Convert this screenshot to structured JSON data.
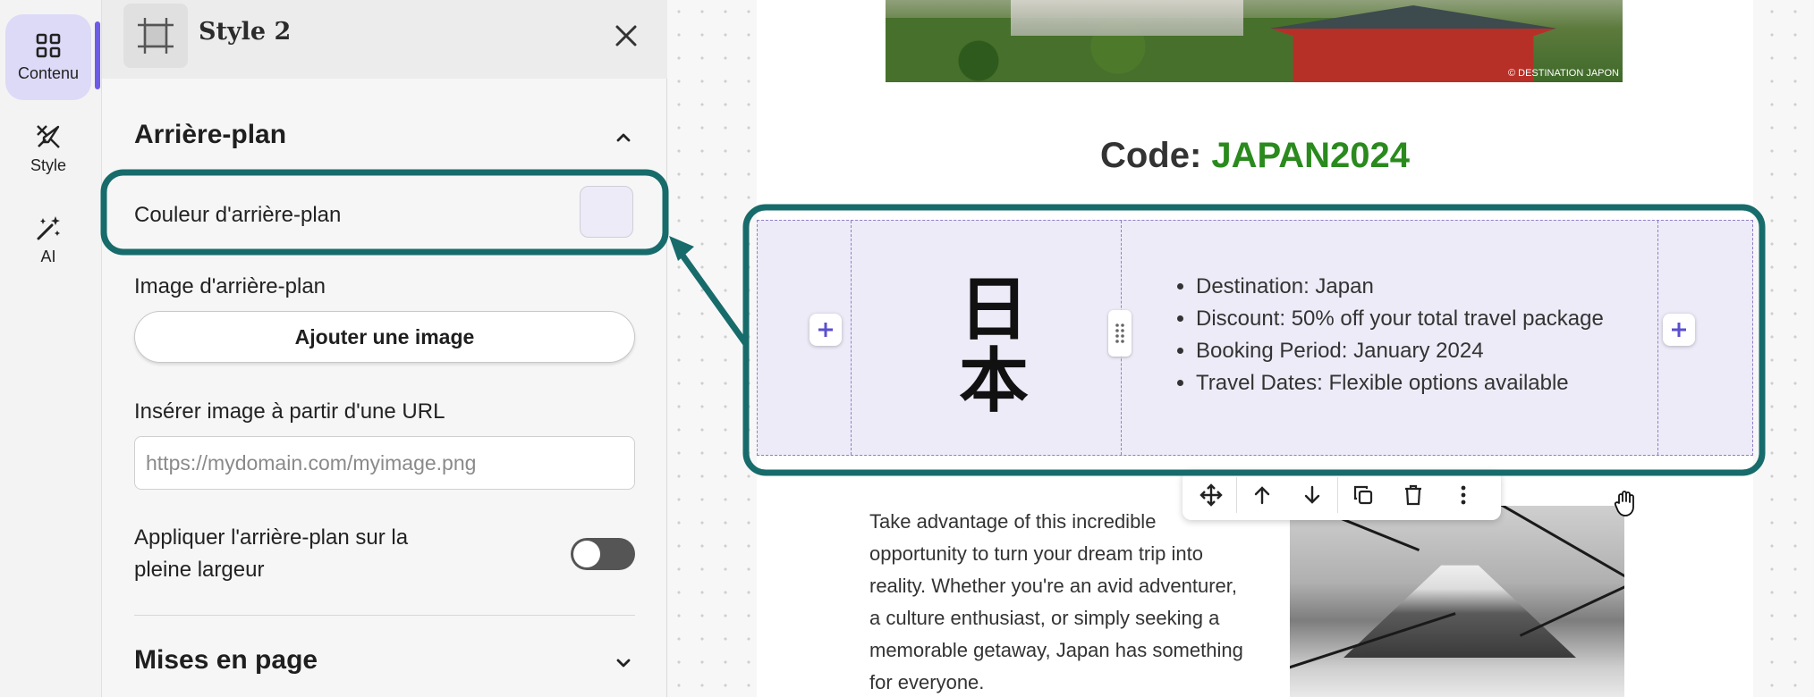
{
  "rail": {
    "items": [
      {
        "label": "Contenu",
        "icon": "grid-icon",
        "active": true
      },
      {
        "label": "Style",
        "icon": "brush-icon",
        "active": false
      },
      {
        "label": "AI",
        "icon": "magic-wand-icon",
        "active": false
      }
    ]
  },
  "panel": {
    "title": "Style 2",
    "section_background": "Arrière-plan",
    "bg_color_label": "Couleur d'arrière-plan",
    "bg_color_value": "#ecebf7",
    "bg_image_label": "Image d'arrière-plan",
    "add_image_label": "Ajouter une image",
    "url_label": "Insérer image à partir d'une URL",
    "url_placeholder": "https://mydomain.com/myimage.png",
    "full_width_label": "Appliquer l'arrière-plan sur la pleine largeur",
    "full_width_on": false,
    "section_layouts": "Mises en page"
  },
  "email": {
    "hero_credit": "© DESTINATION JAPON",
    "code_prefix": "Code: ",
    "code_value": "JAPAN2024",
    "kanji": "日本",
    "bullets": [
      "Destination: Japan",
      "Discount: 50% off your total travel package",
      "Booking Period: January 2024",
      "Travel Dates: Flexible options available"
    ],
    "body_text": "Take advantage of this incredible opportunity to turn your dream trip into reality. Whether you're an avid adventurer, a culture enthusiast, or simply seeking a memorable getaway, Japan has something for everyone."
  },
  "toolbar": {
    "buttons": [
      "move-icon",
      "arrow-up-icon",
      "arrow-down-icon",
      "duplicate-icon",
      "trash-icon",
      "more-vertical-icon"
    ]
  },
  "colors": {
    "accent": "#6c5ce7",
    "highlight": "#176b6b",
    "code_green": "#2a8a1d",
    "block_bg": "#edebf7"
  }
}
